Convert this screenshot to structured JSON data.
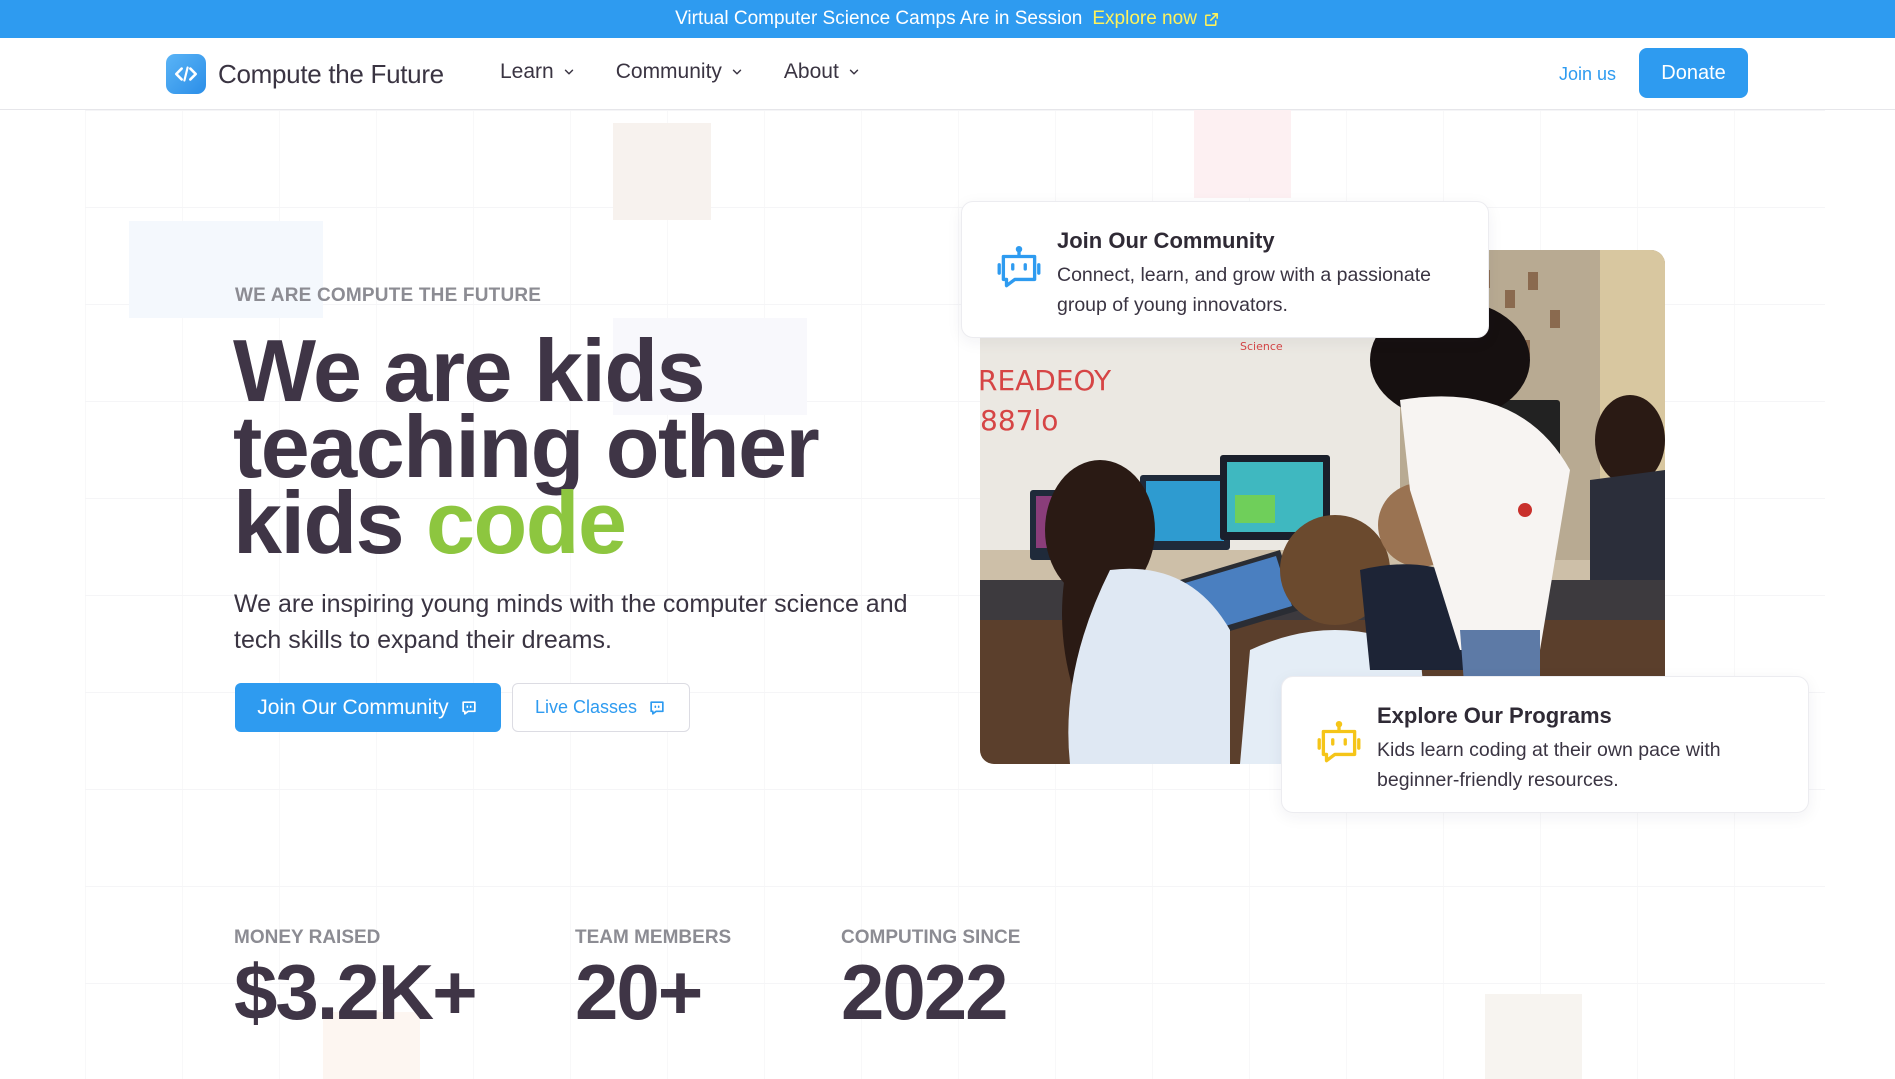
{
  "announcement": {
    "text": "Virtual Computer Science Camps Are in Session",
    "link_text": "Explore now"
  },
  "nav": {
    "brand": "Compute the Future",
    "menu": [
      {
        "label": "Learn"
      },
      {
        "label": "Community"
      },
      {
        "label": "About"
      }
    ],
    "join_label": "Join us",
    "donate_label": "Donate"
  },
  "hero": {
    "eyebrow": "WE ARE COMPUTE THE FUTURE",
    "headline": "We are kids teaching other kids",
    "headline_accent": "code",
    "subtext": "We are inspiring young minds with the computer science and tech skills to expand their dreams.",
    "primary_button": "Join Our Community",
    "secondary_button": "Live Classes",
    "photo_whiteboard": [
      "READEOY",
      "887lo"
    ],
    "photo_corner_text": "Science"
  },
  "cards": [
    {
      "title": "Join Our Community",
      "description": "Connect, learn, and grow with a passionate group of young innovators.",
      "icon": "robot-chat-icon",
      "color": "#2e9bf0"
    },
    {
      "title": "Explore Our Programs",
      "description": "Kids learn coding at their own pace with beginner-friendly resources.",
      "icon": "robot-chat-icon",
      "color": "#f5c518"
    }
  ],
  "stats": [
    {
      "label": "MONEY RAISED",
      "value": "$3.2K+"
    },
    {
      "label": "TEAM MEMBERS",
      "value": "20+"
    },
    {
      "label": "COMPUTING SINCE",
      "value": "2022"
    }
  ],
  "colors": {
    "primary": "#2e9bf0",
    "accent_green": "#8dc63f",
    "heading": "#3f3546",
    "announcement_link": "#fff25a"
  }
}
